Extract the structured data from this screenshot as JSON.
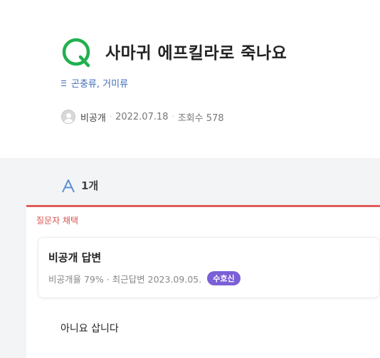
{
  "question": {
    "mark": "Q",
    "title": "사마귀 에프킬라로 죽나요",
    "category": "곤충류, 거미류",
    "author": "비공개",
    "date": "2022.07.18",
    "views_label": "조회수 578"
  },
  "answers": {
    "mark": "A",
    "count_label": "1개",
    "items": [
      {
        "adopted_label": "질문자 채택",
        "author": "비공개 답변",
        "stats": "비공개율 79% · 최근답변 2023.09.05.",
        "badge": "수호신",
        "body": "아니요 삽니다"
      }
    ]
  },
  "colors": {
    "q_green": "#1fb14f",
    "a_blue": "#5b8fd6",
    "category_blue": "#3f6bb8",
    "adopted_red": "#e05c5c",
    "badge_purple": "#7b5fd6"
  }
}
